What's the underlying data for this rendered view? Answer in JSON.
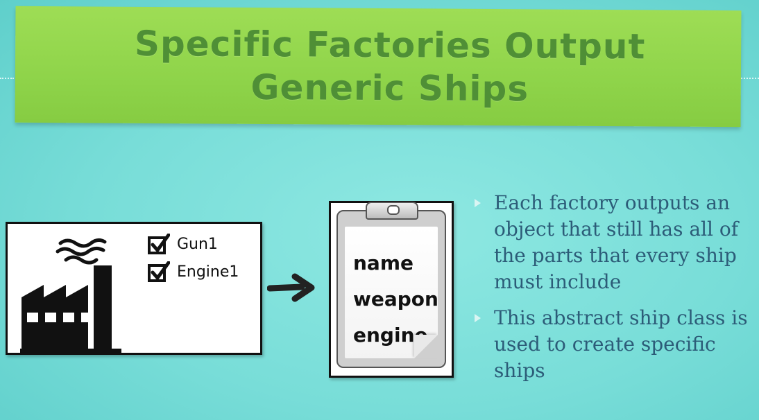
{
  "slide": {
    "title": "Specific Factories Output Generic Ships"
  },
  "factory_card": {
    "checklist": [
      {
        "label": "Gun1"
      },
      {
        "label": "Engine1"
      }
    ]
  },
  "clipboard": {
    "fields": [
      "name",
      "weapon",
      "engine"
    ]
  },
  "bullets": [
    "Each factory outputs an object that still has all of the parts that every ship must include",
    "This abstract ship class is used to create specific ships"
  ],
  "colors": {
    "background": "#78ddd8",
    "banner": "#8fd44a",
    "title_text": "#4f8f36",
    "bullet_text": "#2c5c78"
  }
}
